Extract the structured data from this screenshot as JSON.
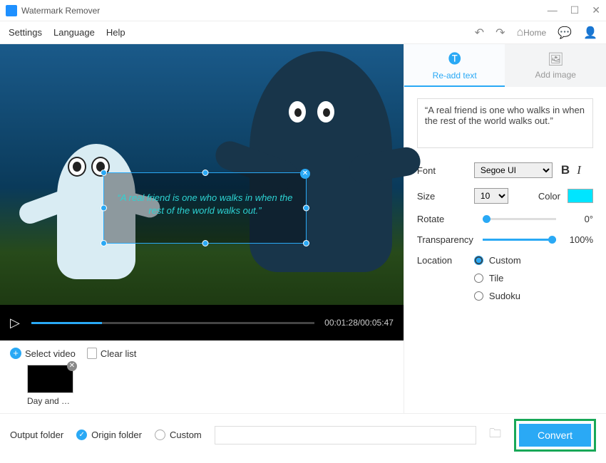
{
  "title": "Watermark Remover",
  "menu": {
    "settings": "Settings",
    "language": "Language",
    "help": "Help",
    "home": "Home"
  },
  "tabs": {
    "readd": "Re-add text",
    "addimg": "Add image"
  },
  "watermark_text": "“A real friend is one who walks in when the rest of the world walks out.”",
  "overlay_text": "“A real friend is one who walks in when the rest of the world walks out.”",
  "font": {
    "label": "Font",
    "value": "Segoe UI"
  },
  "size": {
    "label": "Size",
    "value": "10"
  },
  "color": {
    "label": "Color",
    "hex": "#00e5ff"
  },
  "rotate": {
    "label": "Rotate",
    "value": "0°",
    "pct": 0
  },
  "transparency": {
    "label": "Transparency",
    "value": "100%",
    "pct": 100
  },
  "location": {
    "label": "Location",
    "options": {
      "custom": "Custom",
      "tile": "Tile",
      "sudoku": "Sudoku"
    },
    "selected": "custom"
  },
  "player": {
    "time": "00:01:28/00:05:47",
    "progress_pct": 25
  },
  "thumbs": {
    "select": "Select video",
    "clear": "Clear list",
    "item": "Day and N..."
  },
  "footer": {
    "output": "Output folder",
    "origin": "Origin folder",
    "custom": "Custom",
    "convert": "Convert"
  }
}
